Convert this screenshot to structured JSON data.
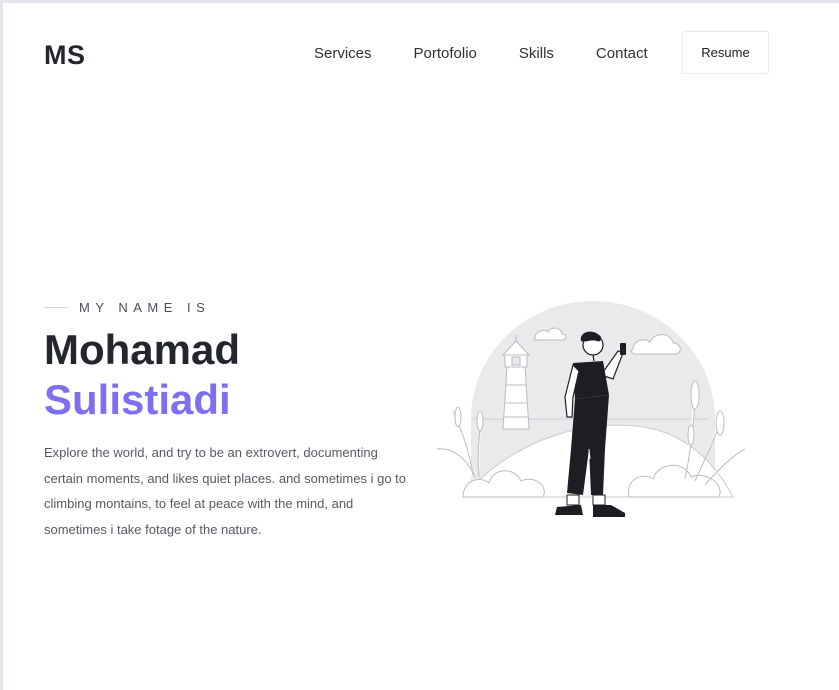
{
  "header": {
    "logo": "MS",
    "nav": [
      "Services",
      "Portofolio",
      "Skills",
      "Contact"
    ],
    "resume_label": "Resume"
  },
  "hero": {
    "eyebrow": "MY NAME IS",
    "first_name": "Mohamad",
    "last_name": "Sulistiadi",
    "bio": "Explore the world, and try to be an extrovert, documenting certain moments, and likes quiet places. and sometimes i go to climbing montains, to feel at peace with the mind, and sometimes i take fotage of the nature.",
    "accent_color": "#7e6ff0"
  },
  "illustration": {
    "icon": "man-with-phone-lighthouse-illustration"
  }
}
